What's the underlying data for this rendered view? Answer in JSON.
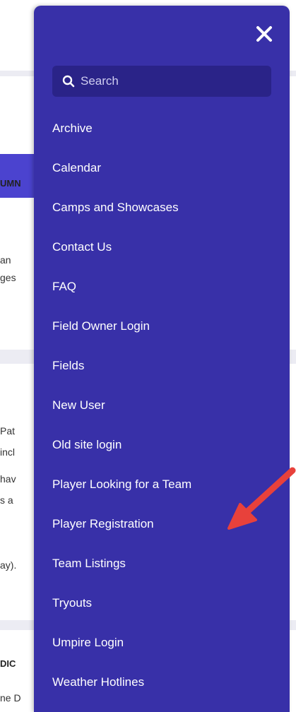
{
  "background": {
    "snippets": [
      "UMN",
      "an",
      "ges",
      "Pat",
      "incl",
      "hav",
      "s a",
      "ay).",
      "DIC",
      "ne D"
    ]
  },
  "menu": {
    "close_icon": "close-icon",
    "search": {
      "placeholder": "Search",
      "icon": "search-icon"
    },
    "items": [
      "Archive",
      "Calendar",
      "Camps and Showcases",
      "Contact Us",
      "FAQ",
      "Field Owner Login",
      "Fields",
      "New User",
      "Old site login",
      "Player Looking for a Team",
      "Player Registration",
      "Team Listings",
      "Tryouts",
      "Umpire Login",
      "Weather Hotlines"
    ]
  },
  "annotation": {
    "arrow_color": "#e8413b"
  }
}
